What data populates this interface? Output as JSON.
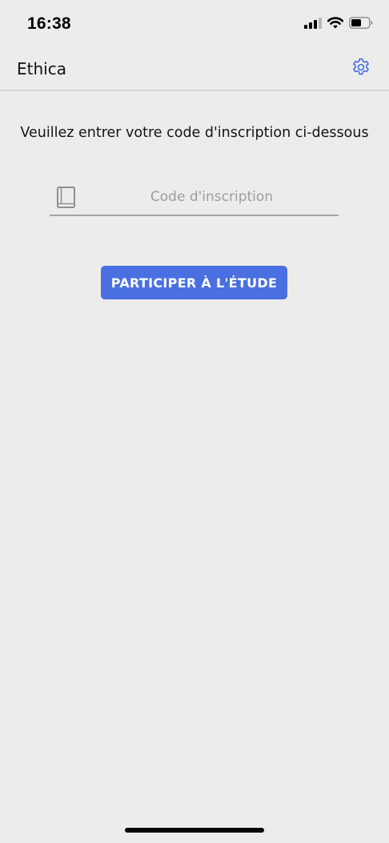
{
  "status_bar": {
    "time": "16:38",
    "icons": [
      "cellular-signal-icon",
      "wifi-icon",
      "battery-icon"
    ]
  },
  "nav": {
    "title": "Ethica",
    "settings_icon": "gear-icon"
  },
  "main": {
    "prompt": "Veuillez entrer votre code d'inscription ci-dessous",
    "code_field": {
      "icon": "book-icon",
      "placeholder": "Code d'inscription",
      "value": ""
    },
    "join_button_label": "PARTICIPER À L'ÉTUDE"
  },
  "colors": {
    "background": "#ececec",
    "accent": "#4a6fe0",
    "divider": "#d6d6d6",
    "placeholder": "#9d9d9d"
  }
}
